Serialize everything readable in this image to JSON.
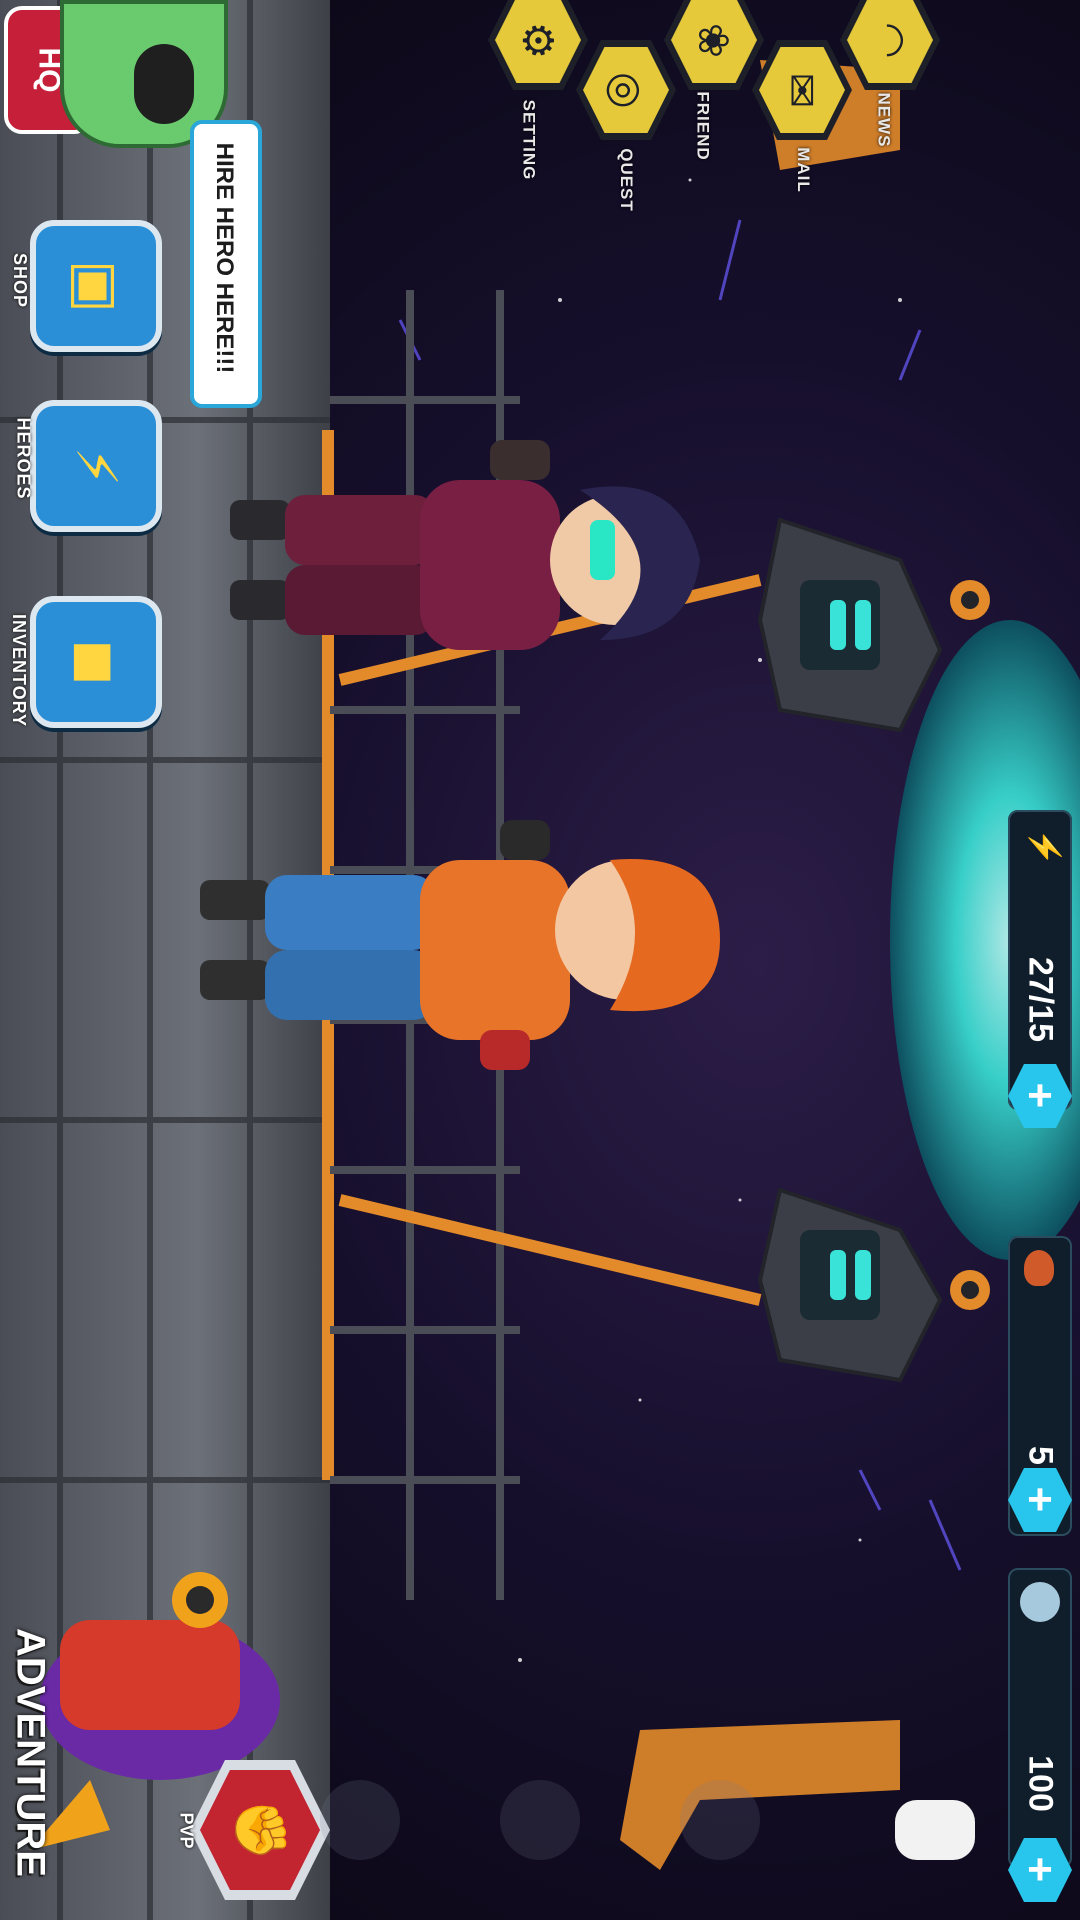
{
  "top_left": {
    "hq_label": "HQ",
    "hire_bubble": "HIRE HERO HERE!!!"
  },
  "nav_icons": [
    {
      "key": "news",
      "label": "NEWS",
      "icon": "wifi-icon",
      "glyph": "◠"
    },
    {
      "key": "mail",
      "label": "MAIL",
      "icon": "mail-icon",
      "glyph": "✉"
    },
    {
      "key": "friend",
      "label": "FRIEND",
      "icon": "paw-icon",
      "glyph": "❀"
    },
    {
      "key": "quest",
      "label": "QUEST",
      "icon": "quest-icon",
      "glyph": "◎"
    },
    {
      "key": "setting",
      "label": "SETTING",
      "icon": "gear-icon",
      "glyph": "⚙"
    }
  ],
  "side_buttons": [
    {
      "key": "shop",
      "label": "SHOP",
      "icon": "shop-icon",
      "glyph": "▣"
    },
    {
      "key": "heroes",
      "label": "HEROES",
      "icon": "lightning-icon",
      "glyph": "⚡"
    },
    {
      "key": "inventory",
      "label": "INVENTORY",
      "icon": "backpack-icon",
      "glyph": "◼"
    }
  ],
  "resources": {
    "energy": "27/15",
    "gems": "5",
    "coins": "100"
  },
  "bottom": {
    "adventure_label": "ADVENTURE",
    "pvp_label": "PVP"
  },
  "colors": {
    "accent_yellow": "#e6c93a",
    "plus_cyan": "#28c6ec",
    "portal_cyan": "#3ae3d8",
    "rail_orange": "#e38a2a"
  }
}
